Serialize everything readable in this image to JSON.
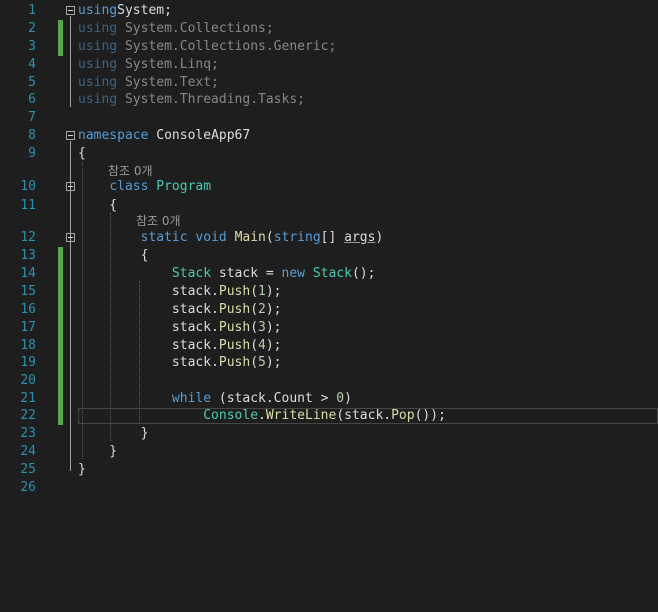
{
  "editor": {
    "lines": [
      {
        "n": "1",
        "tokens": [
          [
            "kw",
            "using"
          ],
          [
            "",
            "System;"
          ]
        ]
      },
      {
        "n": "2",
        "tokens": [
          [
            "kw dim",
            "using"
          ],
          [
            "dim",
            " System.Collections;"
          ]
        ]
      },
      {
        "n": "3",
        "tokens": [
          [
            "kw dim",
            "using"
          ],
          [
            "dim",
            " System.Collections.Generic;"
          ]
        ]
      },
      {
        "n": "4",
        "tokens": [
          [
            "kw dim",
            "using"
          ],
          [
            "dim",
            " System.Linq;"
          ]
        ]
      },
      {
        "n": "5",
        "tokens": [
          [
            "kw dim",
            "using"
          ],
          [
            "dim",
            " System.Text;"
          ]
        ]
      },
      {
        "n": "6",
        "tokens": [
          [
            "kw dim",
            "using"
          ],
          [
            "dim",
            " System.Threading.Tasks;"
          ]
        ]
      },
      {
        "n": "7",
        "tokens": []
      },
      {
        "n": "8",
        "tokens": [
          [
            "kw",
            "namespace"
          ],
          [
            "",
            " ConsoleApp67"
          ]
        ]
      },
      {
        "n": "9",
        "tokens": [
          [
            "",
            "{"
          ]
        ]
      },
      {
        "n": "10",
        "tokens": [
          [
            "",
            "    "
          ],
          [
            "kw",
            "class"
          ],
          [
            "",
            " "
          ],
          [
            "type",
            "Program"
          ]
        ]
      },
      {
        "n": "11",
        "tokens": [
          [
            "",
            "    {"
          ]
        ]
      },
      {
        "n": "12",
        "tokens": [
          [
            "",
            "        "
          ],
          [
            "kw",
            "static"
          ],
          [
            "",
            " "
          ],
          [
            "kw",
            "void"
          ],
          [
            "",
            " "
          ],
          [
            "method",
            "Main"
          ],
          [
            "",
            "("
          ],
          [
            "kw",
            "string"
          ],
          [
            "",
            "[] "
          ],
          [
            "ul",
            "args"
          ],
          [
            "",
            ")"
          ]
        ]
      },
      {
        "n": "13",
        "tokens": [
          [
            "",
            "        {"
          ]
        ]
      },
      {
        "n": "14",
        "tokens": [
          [
            "",
            "            "
          ],
          [
            "type",
            "Stack"
          ],
          [
            "",
            " stack = "
          ],
          [
            "kw",
            "new"
          ],
          [
            "",
            " "
          ],
          [
            "type",
            "Stack"
          ],
          [
            "",
            "();"
          ]
        ]
      },
      {
        "n": "15",
        "tokens": [
          [
            "",
            "            stack."
          ],
          [
            "method",
            "Push"
          ],
          [
            "",
            "("
          ],
          [
            "num",
            "1"
          ],
          [
            "",
            ");"
          ]
        ]
      },
      {
        "n": "16",
        "tokens": [
          [
            "",
            "            stack."
          ],
          [
            "method",
            "Push"
          ],
          [
            "",
            "("
          ],
          [
            "num",
            "2"
          ],
          [
            "",
            ");"
          ]
        ]
      },
      {
        "n": "17",
        "tokens": [
          [
            "",
            "            stack."
          ],
          [
            "method",
            "Push"
          ],
          [
            "",
            "("
          ],
          [
            "num",
            "3"
          ],
          [
            "",
            ");"
          ]
        ]
      },
      {
        "n": "18",
        "tokens": [
          [
            "",
            "            stack."
          ],
          [
            "method",
            "Push"
          ],
          [
            "",
            "("
          ],
          [
            "num",
            "4"
          ],
          [
            "",
            ");"
          ]
        ]
      },
      {
        "n": "19",
        "tokens": [
          [
            "",
            "            stack."
          ],
          [
            "method",
            "Push"
          ],
          [
            "",
            "("
          ],
          [
            "num",
            "5"
          ],
          [
            "",
            ");"
          ]
        ]
      },
      {
        "n": "20",
        "tokens": []
      },
      {
        "n": "21",
        "tokens": [
          [
            "",
            "            "
          ],
          [
            "kw",
            "while"
          ],
          [
            "",
            " (stack.Count > "
          ],
          [
            "num",
            "0"
          ],
          [
            "",
            ")"
          ]
        ]
      },
      {
        "n": "22",
        "tokens": [
          [
            "",
            "                "
          ],
          [
            "type",
            "Console"
          ],
          [
            "",
            "."
          ],
          [
            "method",
            "WriteLine"
          ],
          [
            "",
            "(stack."
          ],
          [
            "method",
            "Pop"
          ],
          [
            "",
            "());"
          ]
        ]
      },
      {
        "n": "23",
        "tokens": [
          [
            "",
            "        }"
          ]
        ]
      },
      {
        "n": "24",
        "tokens": [
          [
            "",
            "    }"
          ]
        ]
      },
      {
        "n": "25",
        "tokens": [
          [
            "",
            "}"
          ]
        ]
      },
      {
        "n": "26",
        "tokens": []
      }
    ],
    "codelens": [
      {
        "text": "참조 0개"
      },
      {
        "text": "참조 0개"
      }
    ]
  },
  "colors": {
    "background": "#1e1e1e",
    "keyword": "#569cd6",
    "type": "#4ec9b0",
    "method": "#dcdcaa",
    "number": "#b5cea8",
    "line_number": "#2b91af",
    "change_bar": "#57a64a"
  }
}
